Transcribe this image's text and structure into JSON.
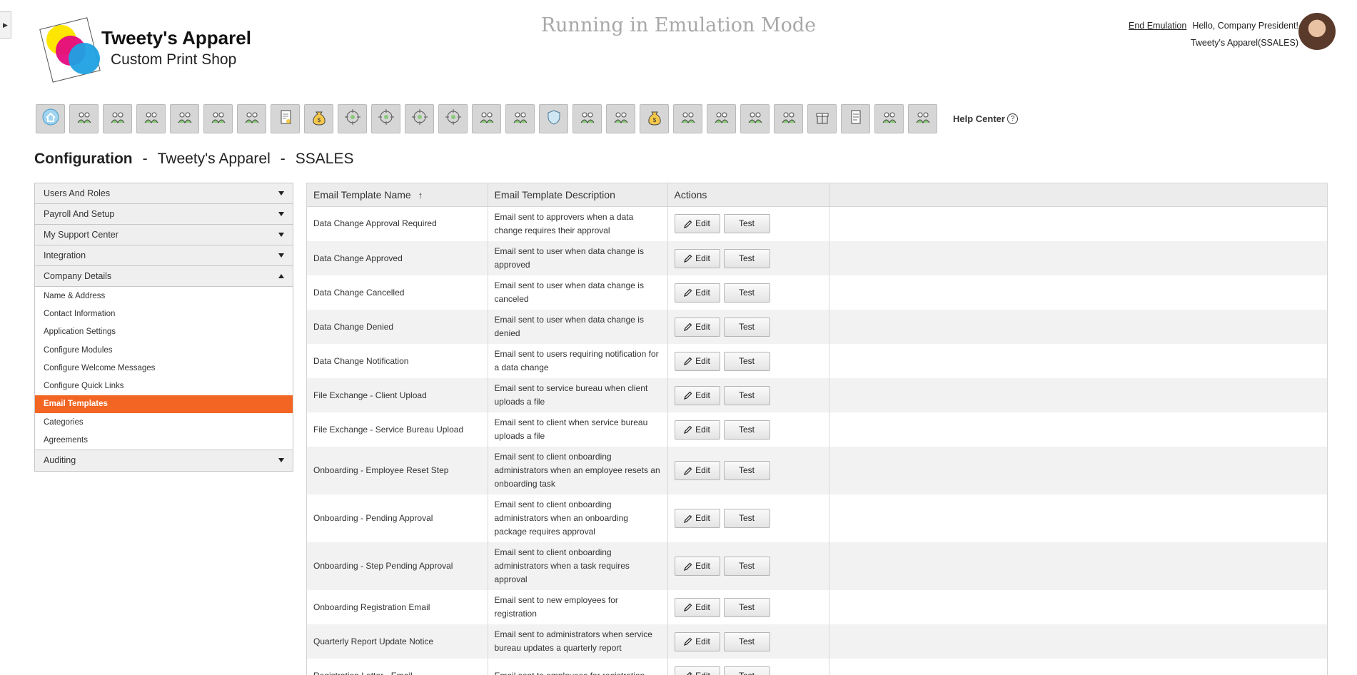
{
  "header": {
    "brand_title": "Tweety's Apparel",
    "brand_subtitle": "Custom Print Shop",
    "emulation_text": "Running in Emulation Mode",
    "end_emulation": "End Emulation",
    "greeting": "Hello, Company President!",
    "company_context": "Tweety's Apparel(SSALES)"
  },
  "toolbar": {
    "icons": [
      "home-icon",
      "award-icon",
      "people-settings-icon",
      "presentation-icon",
      "team-search-icon",
      "training-icon",
      "org-chart-icon",
      "document-icon",
      "money-bag-icon",
      "target-icon",
      "target-icon",
      "target-icon",
      "target-icon",
      "temperature-icon",
      "presenter-icon",
      "shield-icon",
      "search-money-icon",
      "target-miss-icon",
      "money-bag-icon",
      "team-growth-icon",
      "presenter-icon",
      "group-money-icon",
      "search-money-icon",
      "gift-icon",
      "form-icon",
      "training-icon",
      "award-search-icon"
    ],
    "help_label": "Help Center",
    "help_glyph": "?"
  },
  "page": {
    "title": "Configuration",
    "sep": "-",
    "company": "Tweety's Apparel",
    "code": "SSALES"
  },
  "sidebar": {
    "sections_top": [
      {
        "label": "Users And Roles"
      },
      {
        "label": "Payroll And Setup"
      },
      {
        "label": "My Support Center"
      },
      {
        "label": "Integration"
      }
    ],
    "open_section": {
      "label": "Company Details",
      "items": [
        {
          "label": "Name & Address"
        },
        {
          "label": "Contact Information"
        },
        {
          "label": "Application Settings"
        },
        {
          "label": "Configure Modules"
        },
        {
          "label": "Configure Welcome Messages"
        },
        {
          "label": "Configure Quick Links"
        },
        {
          "label": "Email Templates"
        },
        {
          "label": "Categories"
        },
        {
          "label": "Agreements"
        }
      ]
    },
    "sections_bottom": [
      {
        "label": "Auditing"
      }
    ]
  },
  "table": {
    "columns": [
      "Email Template Name",
      "Email Template Description",
      "Actions"
    ],
    "sort_indicator": "↑",
    "edit_label": "Edit",
    "test_label": "Test",
    "rows": [
      {
        "name": "Data Change Approval Required",
        "desc": "Email sent to approvers when a data change requires their approval"
      },
      {
        "name": "Data Change Approved",
        "desc": "Email sent to user when data change is approved"
      },
      {
        "name": "Data Change Cancelled",
        "desc": "Email sent to user when data change is canceled"
      },
      {
        "name": "Data Change Denied",
        "desc": "Email sent to user when data change is denied"
      },
      {
        "name": "Data Change Notification",
        "desc": "Email sent to users requiring notification for a data change"
      },
      {
        "name": "File Exchange - Client Upload",
        "desc": "Email sent to service bureau when client uploads a file"
      },
      {
        "name": "File Exchange - Service Bureau Upload",
        "desc": "Email sent to client when service bureau uploads a file"
      },
      {
        "name": "Onboarding - Employee Reset Step",
        "desc": "Email sent to client onboarding administrators when an employee resets an onboarding task"
      },
      {
        "name": "Onboarding - Pending Approval",
        "desc": "Email sent to client onboarding administrators when an onboarding package requires approval"
      },
      {
        "name": "Onboarding - Step Pending Approval",
        "desc": "Email sent to client onboarding administrators when a task requires approval"
      },
      {
        "name": "Onboarding Registration Email",
        "desc": "Email sent to new employees for registration"
      },
      {
        "name": "Quarterly Report Update Notice",
        "desc": "Email sent to administrators when service bureau updates a quarterly report"
      },
      {
        "name": "Registration Letter - Email",
        "desc": "Email sent to employees for registration"
      }
    ]
  },
  "colors": {
    "accent": "#f26522",
    "logo_yellow": "#ffe600",
    "logo_magenta": "#e5097f",
    "logo_cyan": "#1da1e2"
  }
}
